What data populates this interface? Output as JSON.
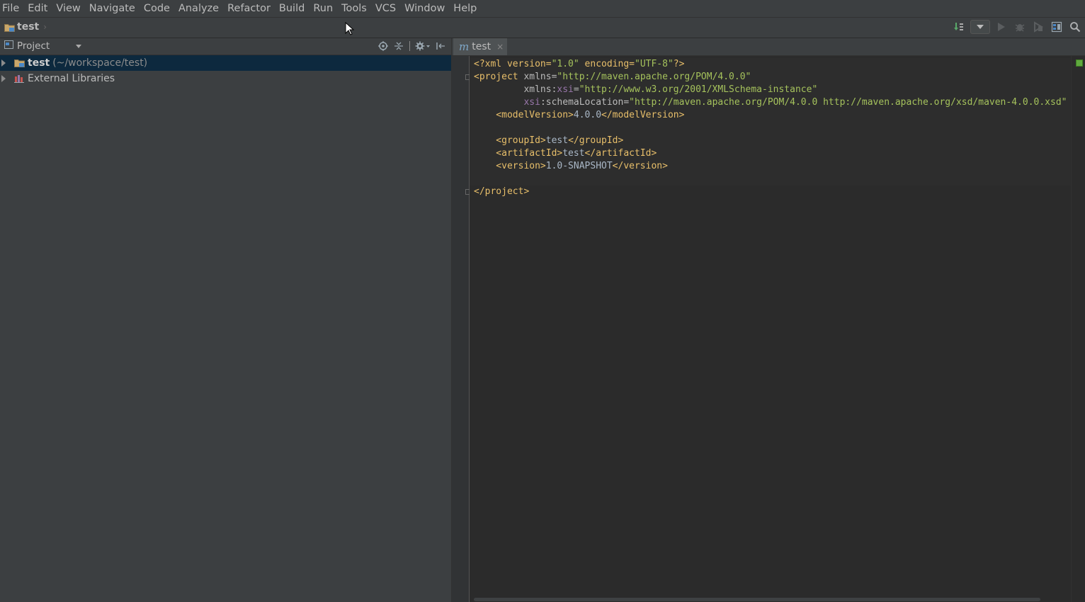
{
  "menu": {
    "items": [
      {
        "mnemonic": "F",
        "rest": "ile"
      },
      {
        "mnemonic": "E",
        "rest": "dit"
      },
      {
        "mnemonic": "V",
        "rest": "iew"
      },
      {
        "mnemonic": "N",
        "rest": "avigate"
      },
      {
        "mnemonic": "C",
        "rest": "ode"
      },
      {
        "mnemonic": "",
        "rest": "Analyze",
        "pre": "",
        "underline_index": 3
      },
      {
        "mnemonic": "R",
        "rest": "efactor"
      },
      {
        "mnemonic": "B",
        "rest": "uild"
      },
      {
        "mnemonic": "",
        "rest": "Run"
      },
      {
        "mnemonic": "T",
        "rest": "ools"
      },
      {
        "mnemonic": "",
        "rest": "VCS"
      },
      {
        "mnemonic": "W",
        "rest": "indow"
      },
      {
        "mnemonic": "H",
        "rest": "elp"
      }
    ],
    "labels": [
      "File",
      "Edit",
      "View",
      "Navigate",
      "Code",
      "Analyze",
      "Refactor",
      "Build",
      "Run",
      "Tools",
      "VCS",
      "Window",
      "Help"
    ]
  },
  "navbar": {
    "breadcrumb": "test",
    "icons": [
      "make-project-icon",
      "run-config-dropdown-icon",
      "run-icon",
      "debug-icon",
      "coverage-icon",
      "project-structure-icon",
      "search-everywhere-icon"
    ]
  },
  "project_panel": {
    "title": "Project",
    "tree": [
      {
        "name": "test",
        "path": "(~/workspace/test)",
        "selected": true,
        "icon": "module-folder-icon"
      },
      {
        "name": "External Libraries",
        "path": "",
        "selected": false,
        "icon": "libraries-icon"
      }
    ]
  },
  "editor": {
    "tab_label": "test",
    "tab_icon": "m",
    "tab_close": "×",
    "lines": {
      "l1": {
        "a": "<?xml version=",
        "b": "\"1.0\"",
        "c": " encoding=",
        "d": "\"UTF-8\"",
        "e": "?>"
      },
      "l2": {
        "a": "<project",
        "b": " xmlns=",
        "c": "\"http://maven.apache.org/POM/4.0.0\""
      },
      "l3": {
        "a": "         xmlns:",
        "b": "xsi",
        "c": "=",
        "d": "\"http://www.w3.org/2001/XMLSchema-instance\""
      },
      "l4": {
        "a": "         ",
        "b": "xsi",
        "c": ":schemaLocation=",
        "d": "\"http://maven.apache.org/POM/4.0.0 http://maven.apache.org/xsd/maven-4.0.0.xsd\""
      },
      "l5": {
        "a": "    <modelVersion>",
        "b": "4.0.0",
        "c": "</modelVersion>"
      },
      "l7": {
        "a": "    <groupId>",
        "b": "test",
        "c": "</groupId>"
      },
      "l8": {
        "a": "    <artifactId>",
        "b": "test",
        "c": "</artifactId>"
      },
      "l9": {
        "a": "    <version>",
        "b": "1.0-SNAPSHOT",
        "c": "</version>"
      },
      "l11": {
        "a": "</project>"
      }
    }
  },
  "colors": {
    "background": "#2b2b2b",
    "panel": "#3c3f41",
    "selection": "#0d293e",
    "tag": "#e8bf6a",
    "string": "#a5c25c",
    "namespace": "#9876aa",
    "status_ok": "#5fa93e"
  }
}
